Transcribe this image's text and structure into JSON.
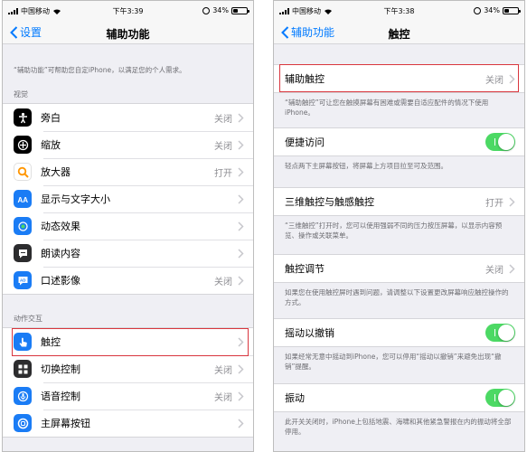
{
  "left": {
    "status": {
      "carrier": "中国移动",
      "time": "下午3:39",
      "battery": "34%"
    },
    "nav": {
      "back_label": "设置",
      "title": "辅助功能"
    },
    "intro": "“辅助功能”可帮助您自定iPhone，以满足您的个人需求。",
    "vision_header": "视觉",
    "vision_items": [
      {
        "label": "旁白",
        "value": "关闭",
        "icon": "voiceover-icon",
        "color": "#000000"
      },
      {
        "label": "缩放",
        "value": "关闭",
        "icon": "zoom-icon",
        "color": "#000000"
      },
      {
        "label": "放大器",
        "value": "打开",
        "icon": "magnifier-icon",
        "color": "#ff9500"
      },
      {
        "label": "显示与文字大小",
        "value": "",
        "icon": "text-size-icon",
        "color": "#1a7cf5"
      },
      {
        "label": "动态效果",
        "value": "",
        "icon": "motion-icon",
        "color": "#1a7cf5"
      },
      {
        "label": "朗读内容",
        "value": "",
        "icon": "speech-icon",
        "color": "#2c2c2e"
      },
      {
        "label": "口述影像",
        "value": "关闭",
        "icon": "audio-description-icon",
        "color": "#1a7cf5"
      }
    ],
    "interaction_header": "动作交互",
    "interaction_items": [
      {
        "label": "触控",
        "value": "",
        "icon": "touch-icon",
        "color": "#1a7cf5"
      },
      {
        "label": "切换控制",
        "value": "关闭",
        "icon": "switch-control-icon",
        "color": "#2c2c2e"
      },
      {
        "label": "语音控制",
        "value": "关闭",
        "icon": "voice-control-icon",
        "color": "#1a7cf5"
      },
      {
        "label": "主屏幕按钮",
        "value": "",
        "icon": "home-button-icon",
        "color": "#1a7cf5"
      }
    ]
  },
  "right": {
    "status": {
      "carrier": "中国移动",
      "time": "下午3:38",
      "battery": "34%"
    },
    "nav": {
      "back_label": "辅助功能",
      "title": "触控"
    },
    "assistive_touch": {
      "label": "辅助触控",
      "value": "关闭",
      "desc": "“辅助触控”可让您在触摸屏幕有困难或需要自适应配件的情况下使用iPhone。"
    },
    "reachability": {
      "label": "便捷访问",
      "on": true,
      "desc": "轻点两下主屏幕按钮，将屏幕上方项目拉至可及范围。"
    },
    "touch_3d": {
      "label": "三维触控与触感触控",
      "value": "打开",
      "desc": "“三维触控”打开时，您可以使用强弱不同的压力按压屏幕，以显示内容预览、操作或关联菜单。"
    },
    "touch_accommodations": {
      "label": "触控调节",
      "value": "关闭",
      "desc": "如果您在使用触控屏时遇到问题，请调整以下设置更改屏幕响应触控操作的方式。"
    },
    "shake_to_undo": {
      "label": "摇动以撤销",
      "on": true,
      "desc": "如果经常无意中摇动到iPhone，您可以停用“摇动以撤销”来避免出现“撤销”提醒。"
    },
    "vibration": {
      "label": "振动",
      "on": true,
      "desc": "此开关关闭时，iPhone上包括地震、海啸和其他紧急警报在内的振动将全部停用。"
    }
  },
  "colors": {
    "accent": "#007aff",
    "toggle_on": "#4cd964",
    "highlight": "#d9363e"
  }
}
